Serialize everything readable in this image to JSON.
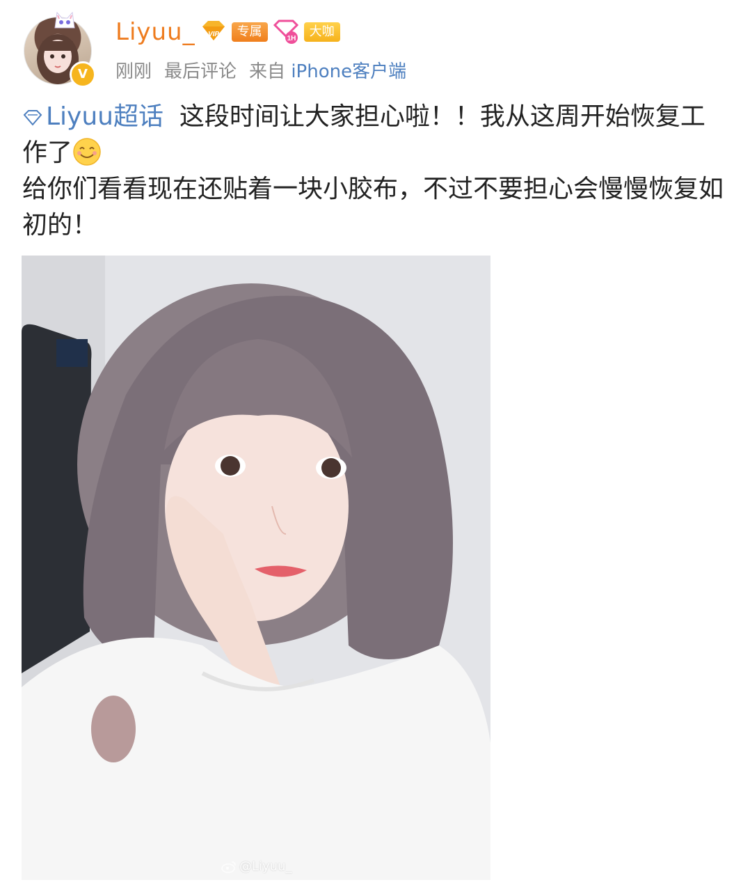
{
  "user": {
    "name": "Liyuu_",
    "badges": [
      "专属",
      "大咖"
    ],
    "verified_mark": "V"
  },
  "meta": {
    "time": "刚刚",
    "action": "最后评论",
    "source_prefix": "来自",
    "client": "iPhone客户端"
  },
  "post": {
    "topic": "Liyuu超话",
    "line1": "这段时间让大家担心啦！！我从这周开始恢复工作了",
    "line2": "给你们看看现在还贴着一块小胶布，不过不要担心会慢慢恢复如初的！"
  },
  "image": {
    "watermark": "@Liyuu_"
  },
  "colors": {
    "username": "#ee7c1f",
    "link": "#4d7fbf",
    "meta": "#8a8a8a",
    "badge_orange": "#f07f1c",
    "badge_gold": "#f6b21c"
  },
  "icons": [
    "vip-icon",
    "level-icon",
    "verified-icon",
    "topic-diamond-icon",
    "smile-emoji-icon",
    "weibo-logo-icon"
  ]
}
